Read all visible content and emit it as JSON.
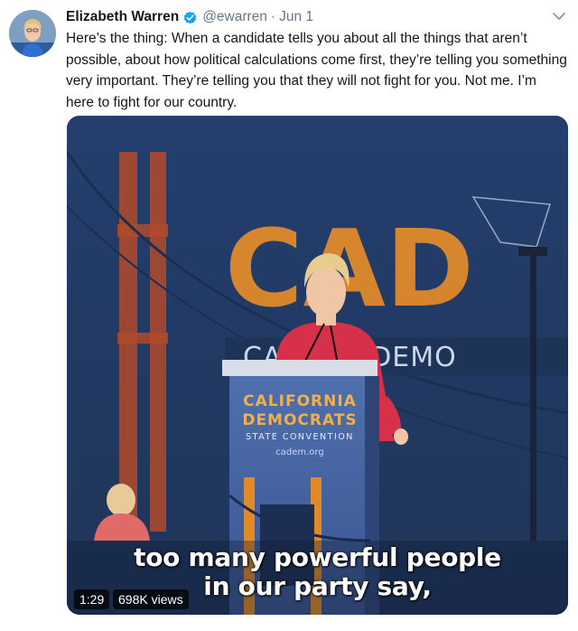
{
  "tweet": {
    "author_name": "Elizabeth Warren",
    "handle": "@ewarren",
    "separator": "·",
    "date": "Jun 1",
    "text": "Here’s the thing: When a candidate tells you about all the things that aren’t possible, about how political calculations come first, they’re telling you something very important. They’re telling you that they will not fight for you. Not me. I’m here to fight for our country."
  },
  "video": {
    "caption_line1": "too many powerful people",
    "caption_line2": "in our party say,",
    "duration": "1:29",
    "views": "698K views",
    "backdrop_letters": "CAD",
    "backdrop_banner": "CA    RNIA DEMO",
    "podium_line1": "CALIFORNIA",
    "podium_line2": "DEMOCRATS",
    "podium_line3": "STATE CONVENTION",
    "podium_url": "cadem.org"
  },
  "icons": {
    "verified": "verified-badge-icon",
    "menu": "chevron-down-icon"
  },
  "colors": {
    "name": "#14171a",
    "secondary": "#657786",
    "verified_blue": "#1da1f2",
    "backdrop_orange": "#e08a2a",
    "backdrop_blue": "#2a4a78"
  }
}
